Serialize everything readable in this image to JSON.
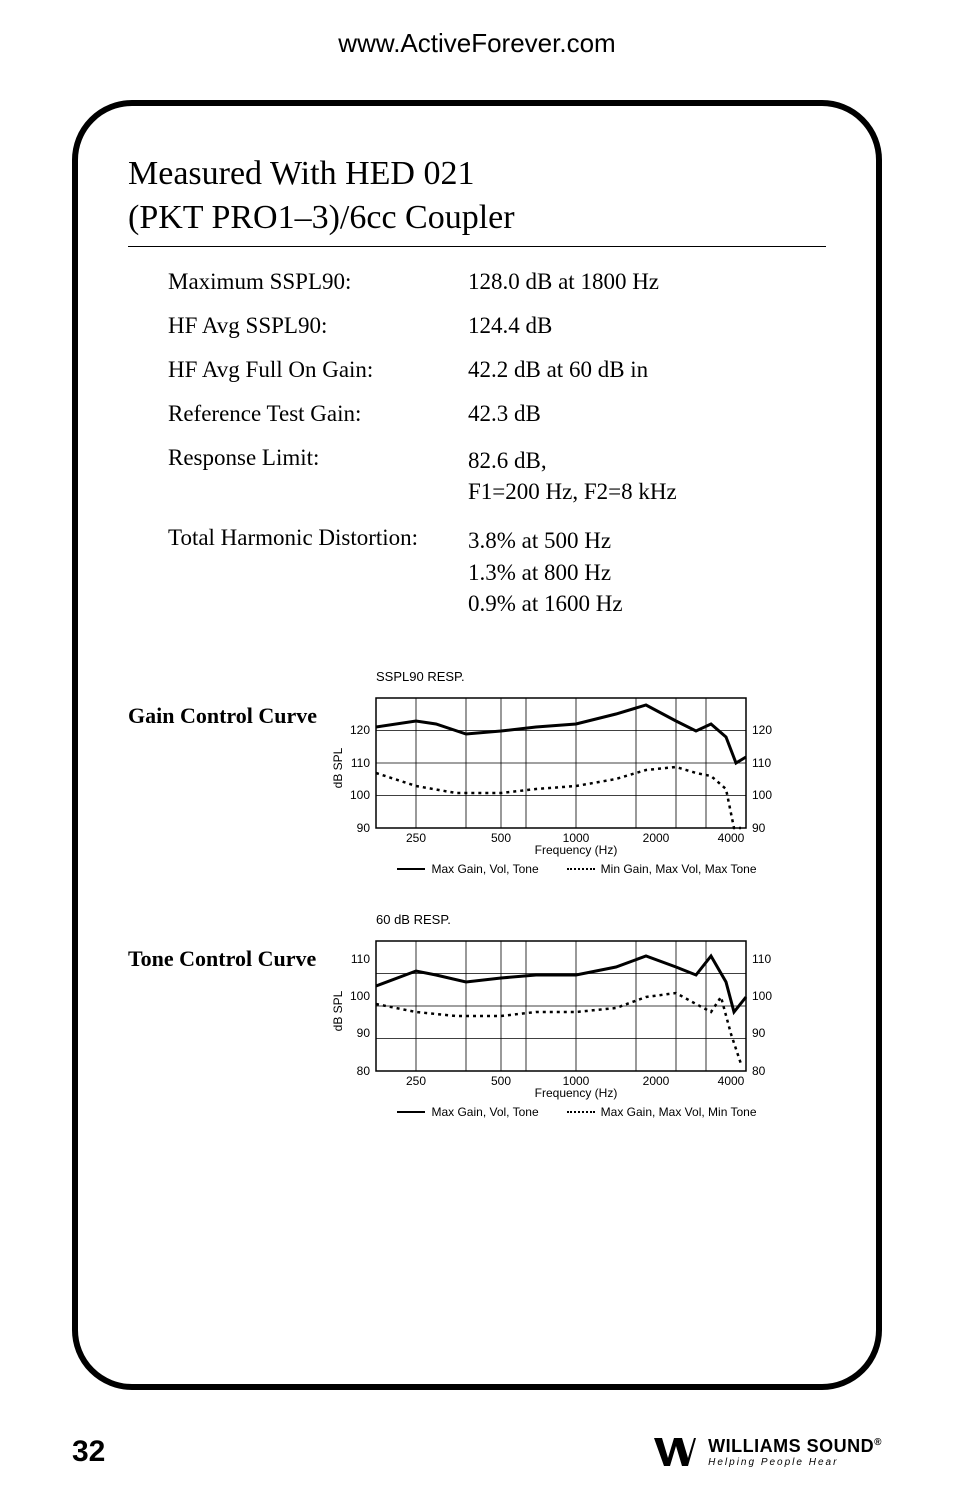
{
  "header_url": "www.ActiveForever.com",
  "title_line1": "Measured With HED 021",
  "title_line2": "(PKT PRO1–3)/6cc Coupler",
  "specs": {
    "max_sspl90": {
      "label": "Maximum SSPL90:",
      "value": "128.0 dB at 1800 Hz"
    },
    "hf_avg_sspl90": {
      "label": "HF Avg SSPL90:",
      "value": "124.4 dB"
    },
    "hf_avg_full_on_gain": {
      "label": "HF Avg Full On Gain:",
      "value": "42.2 dB at 60 dB in"
    },
    "ref_test_gain": {
      "label": "Reference Test Gain:",
      "value": "42.3 dB"
    },
    "response_limit": {
      "label": "Response Limit:",
      "value1": "82.6 dB,",
      "value2": "F1=200 Hz, F2=8 kHz"
    },
    "thd": {
      "label": "Total Harmonic Distortion:",
      "v1": "3.8% at 500 Hz",
      "v2": "1.3% at 800 Hz",
      "v3": "0.9% at 1600 Hz"
    }
  },
  "charts": {
    "gain": {
      "section_label": "Gain Control Curve",
      "title": "SSPL90 RESP.",
      "y_ticks": [
        "120",
        "110",
        "100",
        "90"
      ],
      "x_ticks": [
        "250",
        "500",
        "1000",
        "2000",
        "4000"
      ],
      "y_axis_label": "dB SPL",
      "x_axis_label": "Frequency (Hz)",
      "legend1": "Max Gain, Vol, Tone",
      "legend2": "Min Gain, Max Vol, Max Tone"
    },
    "tone": {
      "section_label": "Tone Control Curve",
      "title": "60 dB RESP.",
      "y_ticks": [
        "110",
        "100",
        "90",
        "80"
      ],
      "x_ticks": [
        "250",
        "500",
        "1000",
        "2000",
        "4000"
      ],
      "y_axis_label": "dB SPL",
      "x_axis_label": "Frequency (Hz)",
      "legend1": "Max Gain, Vol, Tone",
      "legend2": "Max Gain, Max Vol, Min Tone"
    }
  },
  "chart_data": [
    {
      "type": "line",
      "title": "SSPL90 RESP.",
      "xlabel": "Frequency (Hz)",
      "ylabel": "dB SPL",
      "x_scale": "log",
      "xlim": [
        200,
        5000
      ],
      "ylim": [
        90,
        130
      ],
      "x_ticks": [
        250,
        500,
        1000,
        2000,
        4000
      ],
      "y_ticks": [
        90,
        100,
        110,
        120
      ],
      "series": [
        {
          "name": "Max Gain, Vol, Tone",
          "style": "solid",
          "x": [
            200,
            250,
            300,
            400,
            500,
            700,
            1000,
            1400,
            1800,
            2200,
            2600,
            3000,
            3500,
            4000,
            4500
          ],
          "values": [
            121,
            123,
            122,
            119,
            120,
            121,
            122,
            125,
            128,
            123,
            120,
            122,
            118,
            110,
            112
          ]
        },
        {
          "name": "Min Gain, Max Vol, Max Tone",
          "style": "dotted",
          "x": [
            200,
            300,
            400,
            600,
            800,
            1000,
            1400,
            1800,
            2200,
            2600,
            3000,
            3500,
            4000,
            4500
          ],
          "values": [
            107,
            103,
            101,
            101,
            102,
            103,
            105,
            108,
            109,
            107,
            106,
            102,
            90,
            90
          ]
        }
      ]
    },
    {
      "type": "line",
      "title": "60 dB RESP.",
      "xlabel": "Frequency (Hz)",
      "ylabel": "dB SPL",
      "x_scale": "log",
      "xlim": [
        200,
        5000
      ],
      "ylim": [
        80,
        115
      ],
      "x_ticks": [
        250,
        500,
        1000,
        2000,
        4000
      ],
      "y_ticks": [
        80,
        90,
        100,
        110
      ],
      "series": [
        {
          "name": "Max Gain, Vol, Tone",
          "style": "solid",
          "x": [
            200,
            250,
            300,
            400,
            500,
            700,
            1000,
            1400,
            1800,
            2200,
            2600,
            3000,
            3500,
            4000,
            4500
          ],
          "values": [
            103,
            107,
            106,
            104,
            105,
            106,
            106,
            108,
            111,
            108,
            106,
            111,
            104,
            96,
            100
          ]
        },
        {
          "name": "Max Gain, Max Vol, Min Tone",
          "style": "dotted",
          "x": [
            200,
            300,
            400,
            600,
            800,
            1000,
            1400,
            1800,
            2200,
            2600,
            3000,
            3500,
            4000,
            4500
          ],
          "values": [
            98,
            96,
            95,
            95,
            96,
            96,
            97,
            100,
            101,
            98,
            96,
            100,
            90,
            82
          ]
        }
      ]
    }
  ],
  "page_number": "32",
  "brand": {
    "name": "WILLIAMS SOUND",
    "reg": "®",
    "tagline": "Helping People Hear"
  }
}
